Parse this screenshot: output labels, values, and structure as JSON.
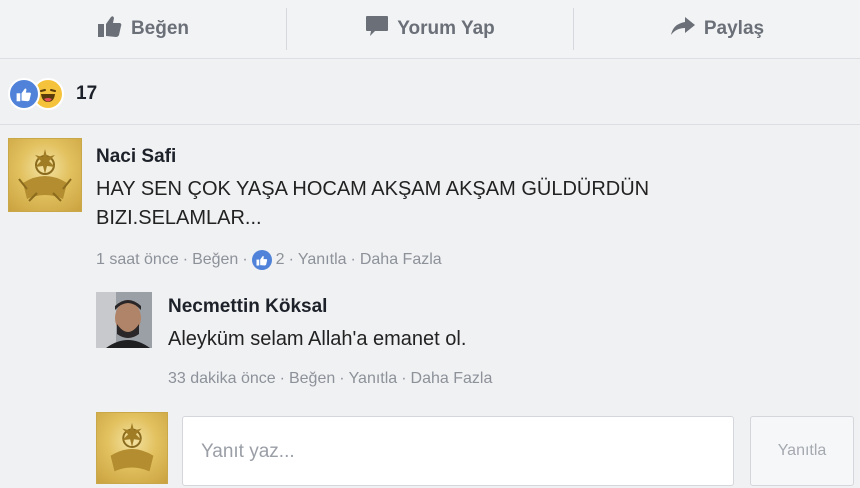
{
  "actions": {
    "like": "Beğen",
    "comment": "Yorum Yap",
    "share": "Paylaş"
  },
  "reactions": {
    "count": "17",
    "types": [
      "like-icon",
      "haha-icon"
    ]
  },
  "comment": {
    "author": "Naci Safi",
    "text_line1": "HAY SEN ÇOK YAŞA HOCAM AKŞAM AKŞAM GÜLDÜRDÜN",
    "text_line2": "BIZI.SELAMLAR...",
    "time": "1 saat önce",
    "like": "Beğen",
    "like_count": "2",
    "reply": "Yanıtla",
    "more": "Daha Fazla"
  },
  "reply": {
    "author": "Necmettin Köksal",
    "text": "Aleyküm selam Allah'a emanet ol.",
    "time": "33 dakika önce",
    "like": "Beğen",
    "reply": "Yanıtla",
    "more": "Daha Fazla"
  },
  "reply_box": {
    "placeholder": "Yanıt yaz...",
    "button": "Yanıtla"
  },
  "colors": {
    "like_blue": "#4f82d8",
    "haha_yellow": "#f5c33b",
    "muted": "#8d9199"
  }
}
